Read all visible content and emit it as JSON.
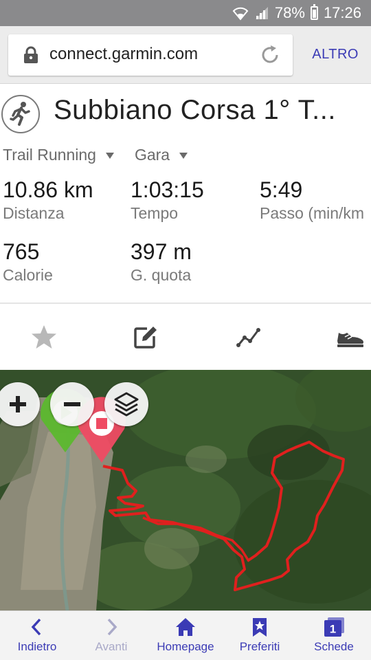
{
  "status_bar": {
    "battery": "78%",
    "time": "17:26",
    "battery_level": 0.78
  },
  "browser": {
    "url": "connect.garmin.com",
    "menu_label": "ALTRO"
  },
  "activity": {
    "title": "Subbiano Corsa 1° T...",
    "type_dropdown": "Trail Running",
    "event_dropdown": "Gara",
    "stats": [
      {
        "value": "10.86 km",
        "label": "Distanza"
      },
      {
        "value": "1:03:15",
        "label": "Tempo"
      },
      {
        "value": "5:49",
        "label": "Passo (min/km"
      },
      {
        "value": "765",
        "label": "Calorie"
      },
      {
        "value": "397 m",
        "label": "G. quota"
      }
    ]
  },
  "toolbar": {
    "icons": [
      "star-icon",
      "edit-icon",
      "chart-line-icon",
      "shoe-icon"
    ]
  },
  "map": {
    "zoom_in": "+",
    "zoom_out": "−",
    "route_color": "#e0201e",
    "start_color": "#5cb82e",
    "end_color": "#ef4b63"
  },
  "bottom_nav": [
    {
      "label": "Indietro",
      "icon": "chevron-left-icon",
      "enabled": true
    },
    {
      "label": "Avanti",
      "icon": "chevron-right-icon",
      "enabled": false
    },
    {
      "label": "Homepage",
      "icon": "home-icon",
      "enabled": true
    },
    {
      "label": "Preferiti",
      "icon": "bookmark-star-icon",
      "enabled": true
    },
    {
      "label": "Schede",
      "icon": "tabs-icon",
      "enabled": true,
      "badge": "1"
    }
  ],
  "colors": {
    "accent": "#3b3bb5",
    "status_bar": "#8a8a8c"
  }
}
